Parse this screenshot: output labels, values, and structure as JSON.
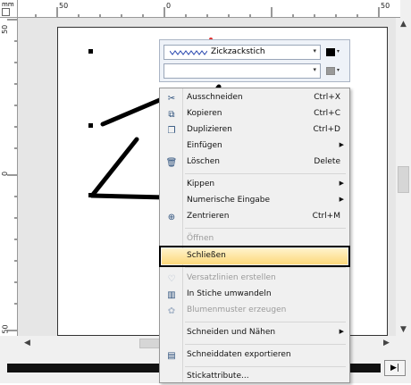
{
  "ruler": {
    "unit": "mm",
    "h_labels": [
      "50",
      "0",
      "50"
    ],
    "v_labels": [
      "50",
      "0",
      "50"
    ]
  },
  "stitch_toolbar": {
    "stitch_name": "Zickzackstich",
    "color": "#000000"
  },
  "context_menu": {
    "items": [
      {
        "label": "Ausschneiden",
        "shortcut": "Ctrl+X",
        "icon": "scissors-icon",
        "enabled": true
      },
      {
        "label": "Kopieren",
        "shortcut": "Ctrl+C",
        "icon": "copy-icon",
        "enabled": true
      },
      {
        "label": "Duplizieren",
        "shortcut": "Ctrl+D",
        "icon": "duplicate-icon",
        "enabled": true
      },
      {
        "label": "Einfügen",
        "shortcut": "",
        "icon": "",
        "enabled": true,
        "submenu": true
      },
      {
        "label": "Löschen",
        "shortcut": "Delete",
        "icon": "trash-icon",
        "enabled": true
      },
      {
        "label": "Kippen",
        "shortcut": "",
        "icon": "",
        "enabled": true,
        "submenu": true
      },
      {
        "label": "Numerische Eingabe",
        "shortcut": "",
        "icon": "",
        "enabled": true,
        "submenu": true
      },
      {
        "label": "Zentrieren",
        "shortcut": "Ctrl+M",
        "icon": "center-icon",
        "enabled": true
      },
      {
        "label": "Öffnen",
        "shortcut": "",
        "icon": "",
        "enabled": false
      },
      {
        "label": "Schließen",
        "shortcut": "",
        "icon": "",
        "enabled": true,
        "highlighted": true
      },
      {
        "label": "Versatzlinien erstellen",
        "shortcut": "",
        "icon": "offset-lines-icon",
        "enabled": false
      },
      {
        "label": "In Stiche umwandeln",
        "shortcut": "",
        "icon": "convert-stitches-icon",
        "enabled": true
      },
      {
        "label": "Blumenmuster erzeugen",
        "shortcut": "",
        "icon": "flower-pattern-icon",
        "enabled": false
      },
      {
        "label": "Schneiden und Nähen",
        "shortcut": "",
        "icon": "",
        "enabled": true,
        "submenu": true
      },
      {
        "label": "Schneiddaten exportieren",
        "shortcut": "",
        "icon": "export-cut-data-icon",
        "enabled": true
      },
      {
        "label": "Stickattribute...",
        "shortcut": "",
        "icon": "",
        "enabled": true
      }
    ]
  },
  "scrollbar": {
    "up": "▲",
    "down": "▼",
    "left": "◀",
    "right": "▶"
  },
  "status_bar": {
    "next_label": "▶|"
  }
}
